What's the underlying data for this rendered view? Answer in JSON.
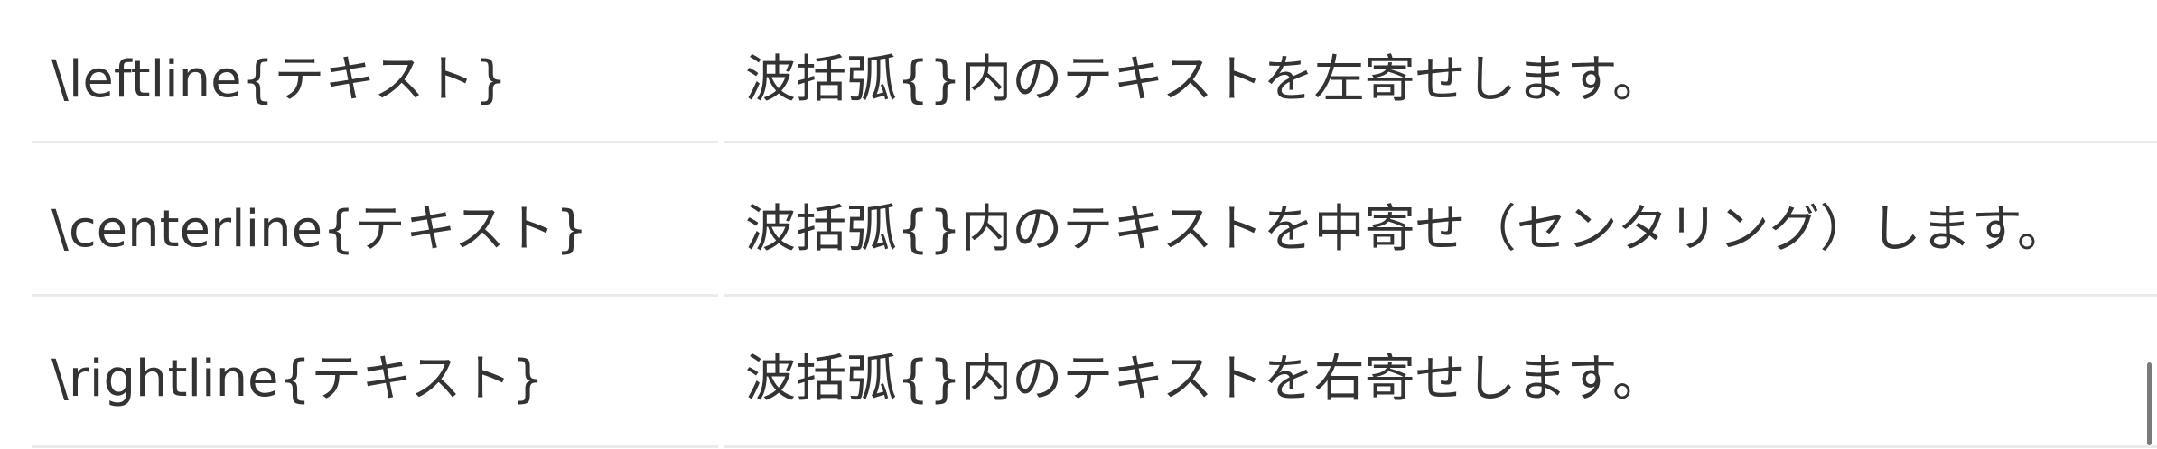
{
  "table": {
    "rows": [
      {
        "command": "\\leftline{テキスト}",
        "description": "波括弧{}内のテキストを左寄せします。"
      },
      {
        "command": "\\centerline{テキスト}",
        "description": "波括弧{}内のテキストを中寄せ（センタリング）します。"
      },
      {
        "command": "\\rightline{テキスト}",
        "description": "波括弧{}内のテキストを右寄せします。"
      }
    ]
  }
}
